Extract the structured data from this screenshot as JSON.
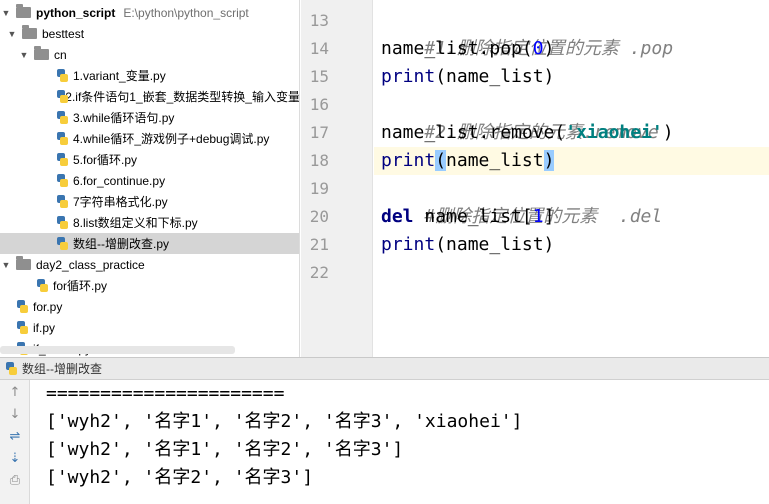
{
  "project": {
    "root_name": "python_script",
    "root_path": "E:\\python\\python_script",
    "folders": {
      "besttest": "besttest",
      "cn": "cn",
      "day2": "day2_class_practice"
    },
    "cn_files": [
      "1.variant_变量.py",
      "2.if条件语句1_嵌套_数据类型转换_输入变量",
      "3.while循环语句.py",
      "4.while循环_游戏例子+debug调试.py",
      "5.for循环.py",
      "6.for_continue.py",
      "7字符串格式化.py",
      "8.list数组定义和下标.py",
      "数组--增删改查.py"
    ],
    "day2_files": [
      "for循环.py"
    ],
    "root_files": [
      "for.py",
      "if.py",
      "if_score.py"
    ]
  },
  "editor": {
    "line_numbers": [
      "13",
      "14",
      "15",
      "16",
      "17",
      "18",
      "19",
      "20",
      "21",
      "22"
    ],
    "code": {
      "l13": "#1.删除指定位置的元素 .pop",
      "l14_a": "name_list.pop(",
      "l14_num": "0",
      "l14_b": ")",
      "l15_fn": "print",
      "l15_rest": "(name_list)",
      "l16": "#2.删除指定的元素.remove",
      "l17_a": "name_list.remove(",
      "l17_str": "'xiaohei'",
      "l17_b": ")",
      "l18_fn": "print",
      "l18_open": "(",
      "l18_mid": "name_list",
      "l18_close": ")",
      "l19": "#删除指定位置的元素  .del",
      "l20_kw": "del",
      "l20_a": " name_list[",
      "l20_num": "1",
      "l20_b": "]",
      "l21_fn": "print",
      "l21_rest": "(name_list)"
    }
  },
  "run": {
    "tab_title": "数组--增删改查",
    "output": [
      "======================",
      "['wyh2', '名字1', '名字2', '名字3', 'xiaohei']",
      "['wyh2', '名字1', '名字2', '名字3']",
      "['wyh2', '名字2', '名字3']"
    ]
  }
}
